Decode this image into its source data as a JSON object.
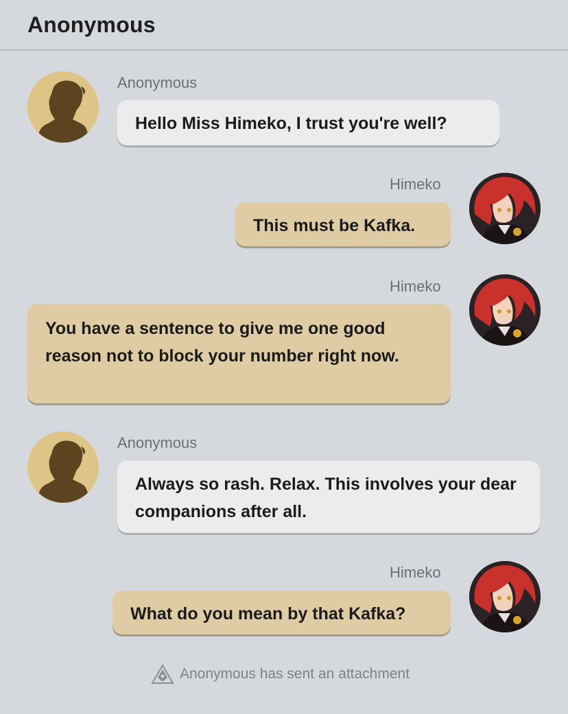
{
  "header": {
    "title": "Anonymous"
  },
  "messages": [
    {
      "sender": "Anonymous",
      "text": "Hello Miss Himeko, I trust you're well?"
    },
    {
      "sender": "Himeko",
      "text": "This must be Kafka."
    },
    {
      "sender": "Himeko",
      "text": "You have a sentence to give me one good reason not to block your number right now."
    },
    {
      "sender": "Anonymous",
      "text": "Always so rash. Relax. This involves your dear companions after all."
    },
    {
      "sender": "Himeko",
      "text": "What do you mean by that Kafka?"
    }
  ],
  "system": {
    "text": "Anonymous has sent an attachment",
    "icon": "attachment-icon"
  },
  "colors": {
    "background": "#d5d9de",
    "anon_bubble": "#ececec",
    "himeko_bubble": "#dfcba4",
    "anon_avatar": "#dfc487"
  }
}
